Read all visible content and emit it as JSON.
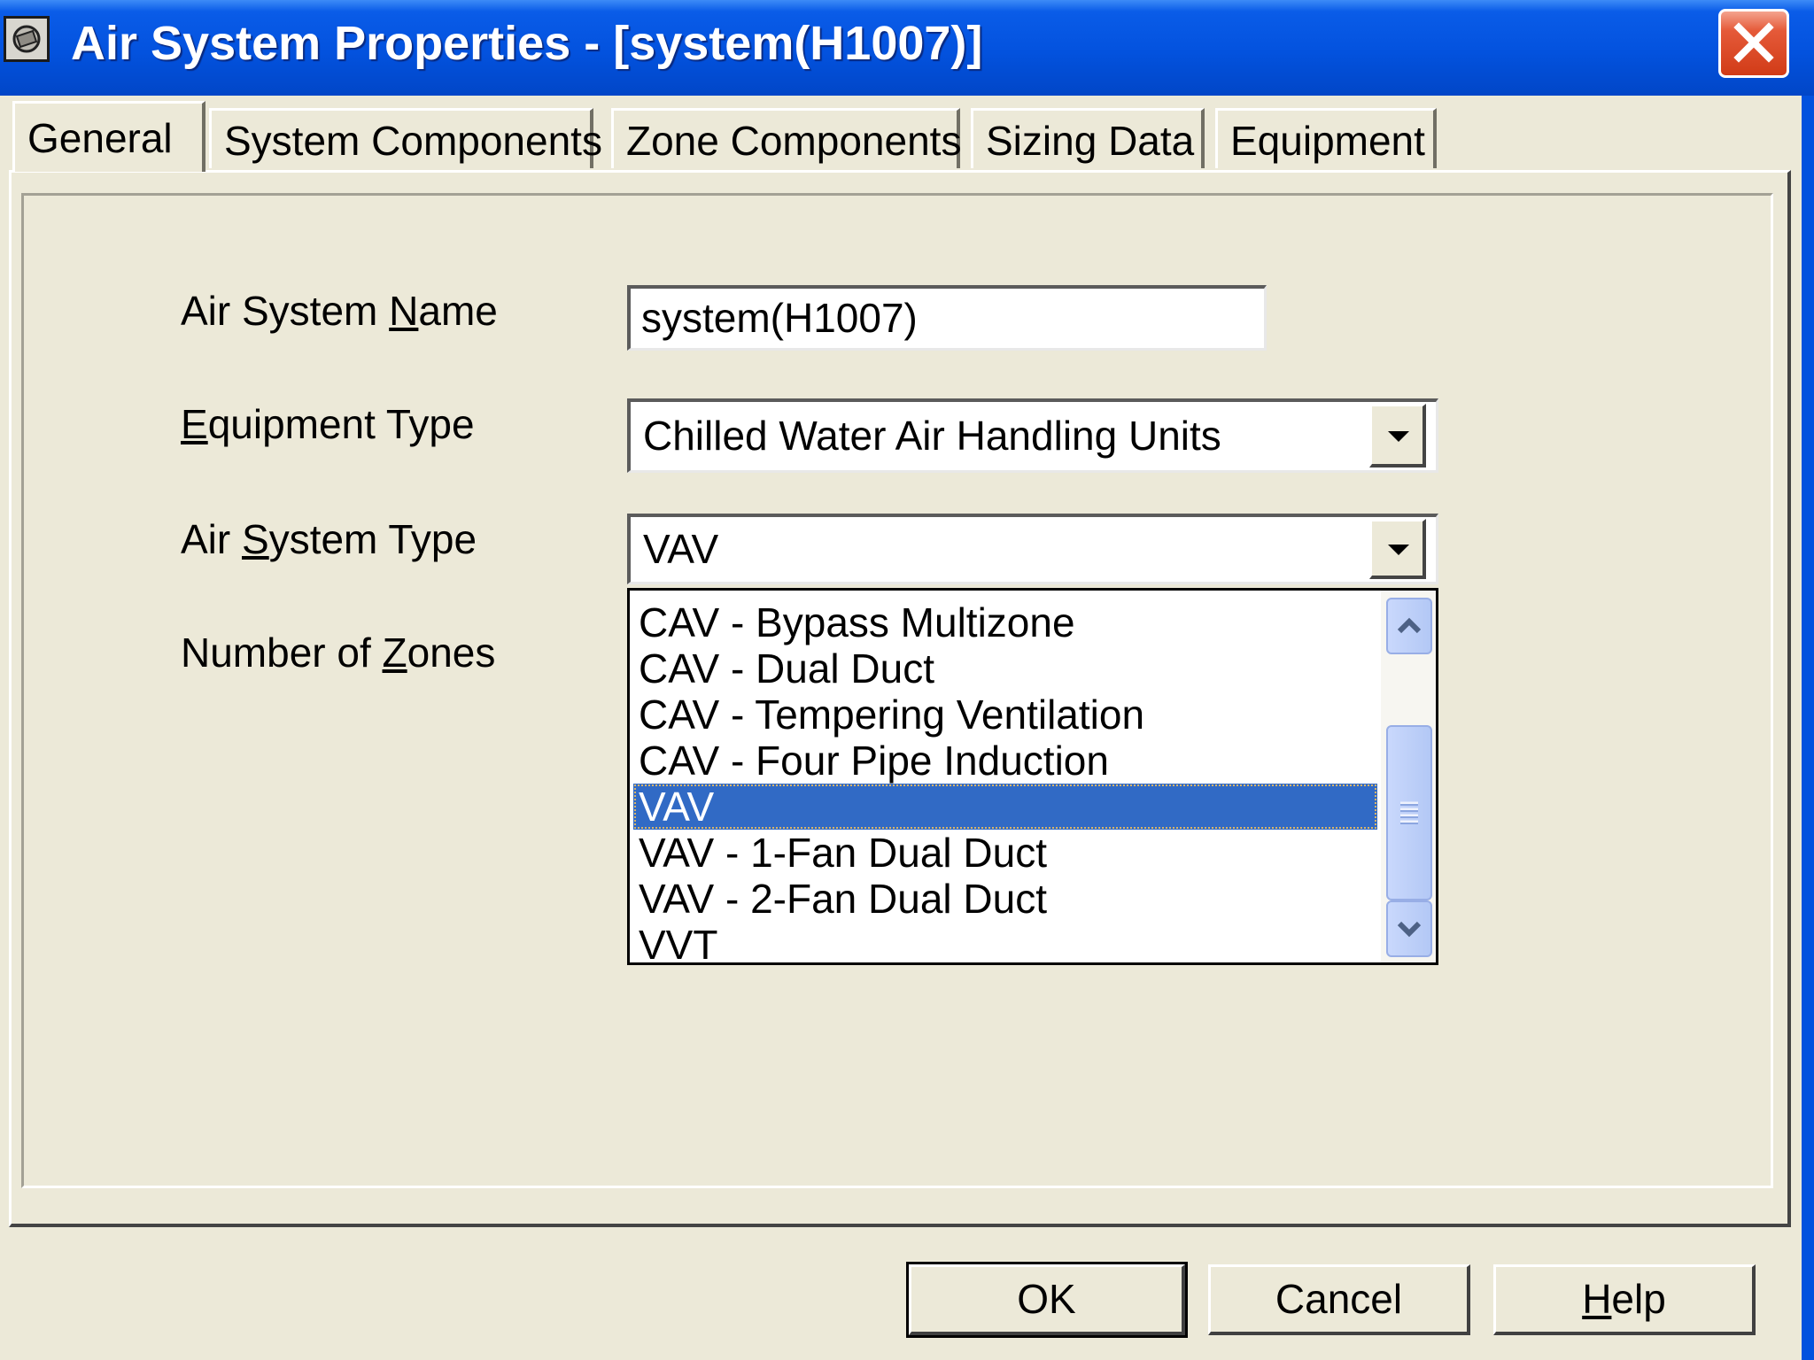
{
  "window": {
    "title": "Air System Properties - [system(H1007)]",
    "close_label": "close"
  },
  "tabs": [
    {
      "label": "General",
      "active": true
    },
    {
      "label": "System Components"
    },
    {
      "label": "Zone Components"
    },
    {
      "label": "Sizing Data"
    },
    {
      "label": "Equipment"
    }
  ],
  "form": {
    "air_system_name": {
      "label_pre": "Air System ",
      "label_key": "N",
      "label_post": "ame",
      "value": "system(H1007)"
    },
    "equipment_type": {
      "label_pre": "",
      "label_key": "E",
      "label_post": "quipment Type",
      "value": "Chilled Water Air Handling Units"
    },
    "air_system_type": {
      "label_pre": "Air ",
      "label_key": "S",
      "label_post": "ystem Type",
      "value": "VAV"
    },
    "number_of_zones": {
      "label_pre": "Number of ",
      "label_key": "Z",
      "label_post": "ones"
    }
  },
  "dropdown": {
    "options": [
      "CAV - Bypass Multizone",
      "CAV - Dual Duct",
      "CAV - Tempering Ventilation",
      "CAV - Four Pipe Induction",
      "VAV",
      "VAV - 1-Fan Dual Duct",
      "VAV - 2-Fan Dual Duct",
      "VVT"
    ],
    "selected": "VAV"
  },
  "buttons": {
    "ok": "OK",
    "cancel": "Cancel",
    "help_key": "H",
    "help_rest": "elp"
  },
  "colors": {
    "titlebar": "#0352DE",
    "dialog_bg": "#ECE9D8",
    "selection": "#316AC5",
    "close_button": "#D13B17"
  }
}
